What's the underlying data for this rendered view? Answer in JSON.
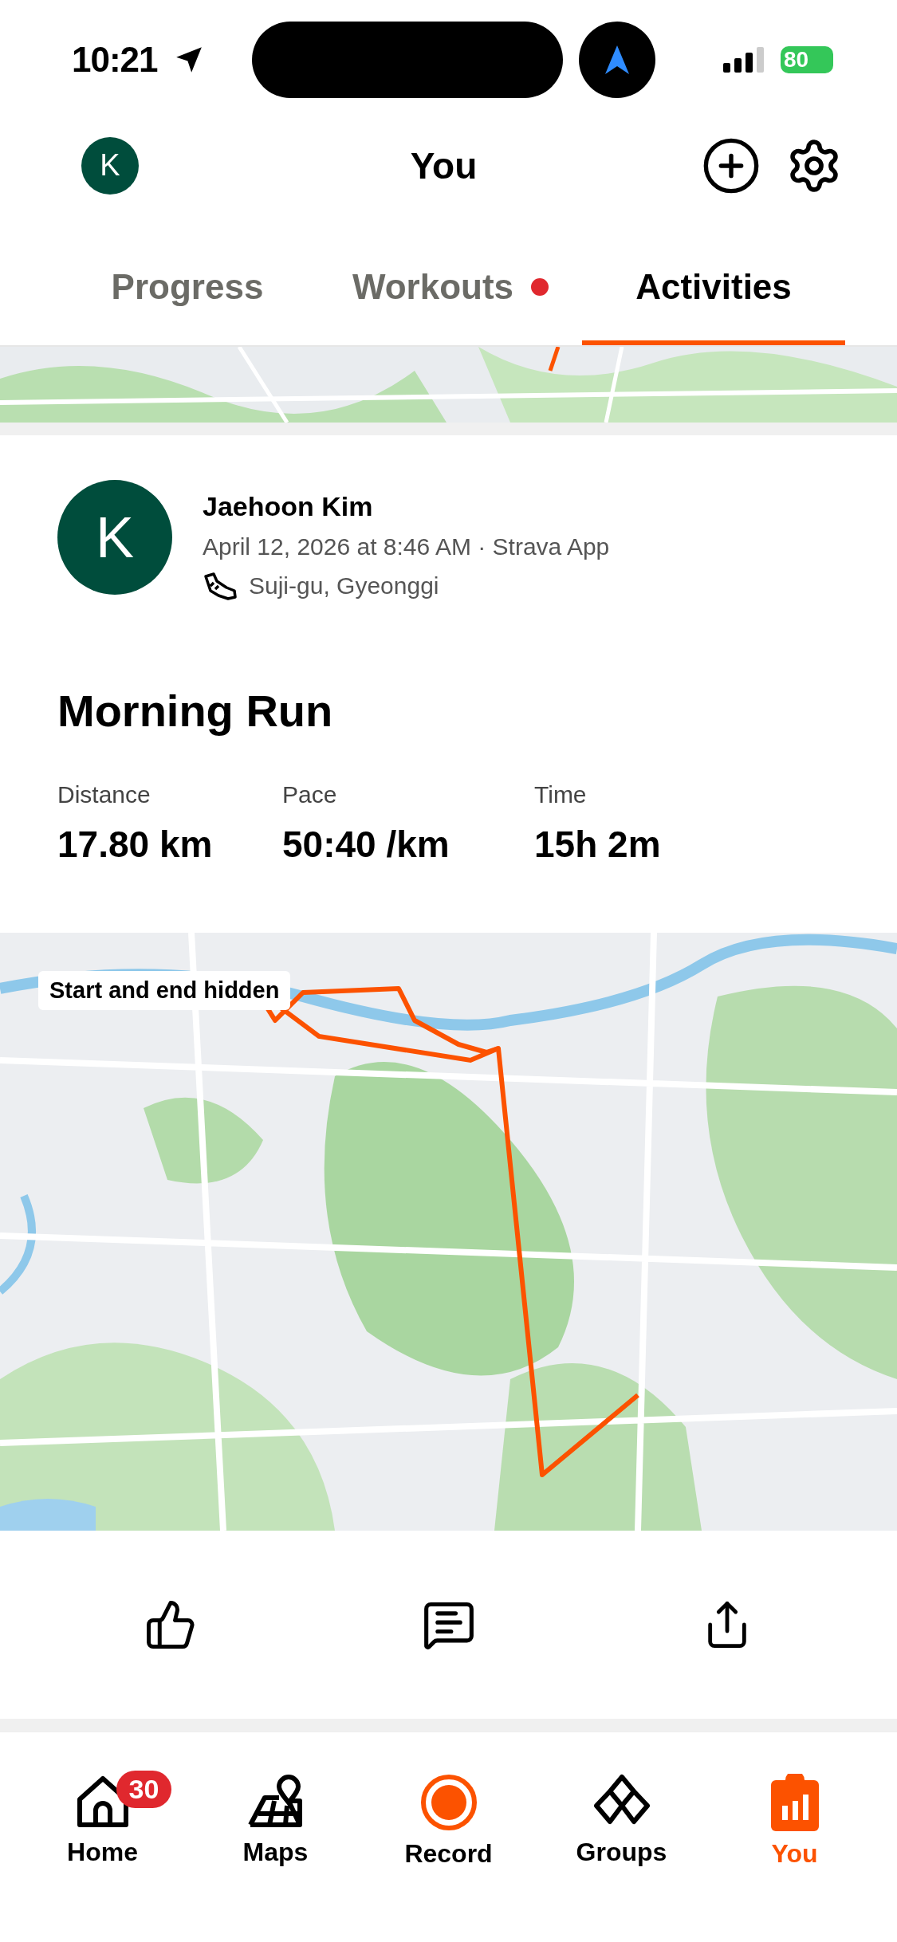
{
  "status_bar": {
    "time": "10:21",
    "battery": "80"
  },
  "header": {
    "avatar": "K",
    "title": "You"
  },
  "tabs": [
    {
      "label": "Progress",
      "selected": false,
      "dot": false
    },
    {
      "label": "Workouts",
      "selected": false,
      "dot": true
    },
    {
      "label": "Activities",
      "selected": true,
      "dot": false
    }
  ],
  "activity": {
    "avatar": "K",
    "name": "Jaehoon Kim",
    "meta": "April 12, 2026 at 8:46 AM · Strava App",
    "location": "Suji-gu, Gyeonggi",
    "title": "Morning Run",
    "stats": [
      {
        "label": "Distance",
        "value": "17.80 km"
      },
      {
        "label": "Pace",
        "value": "50:40 /km"
      },
      {
        "label": "Time",
        "value": "15h 2m"
      }
    ],
    "map": {
      "kind": "picture",
      "badge": "Start and end hidden"
    }
  },
  "nav": [
    {
      "kind": "home",
      "label": "Home",
      "badge": "30",
      "selected": false
    },
    {
      "kind": "maps",
      "label": "Maps",
      "selected": false
    },
    {
      "kind": "record",
      "label": "Record",
      "selected": false
    },
    {
      "kind": "groups",
      "label": "Groups",
      "selected": false
    },
    {
      "kind": "you",
      "label": "You",
      "selected": true
    }
  ]
}
